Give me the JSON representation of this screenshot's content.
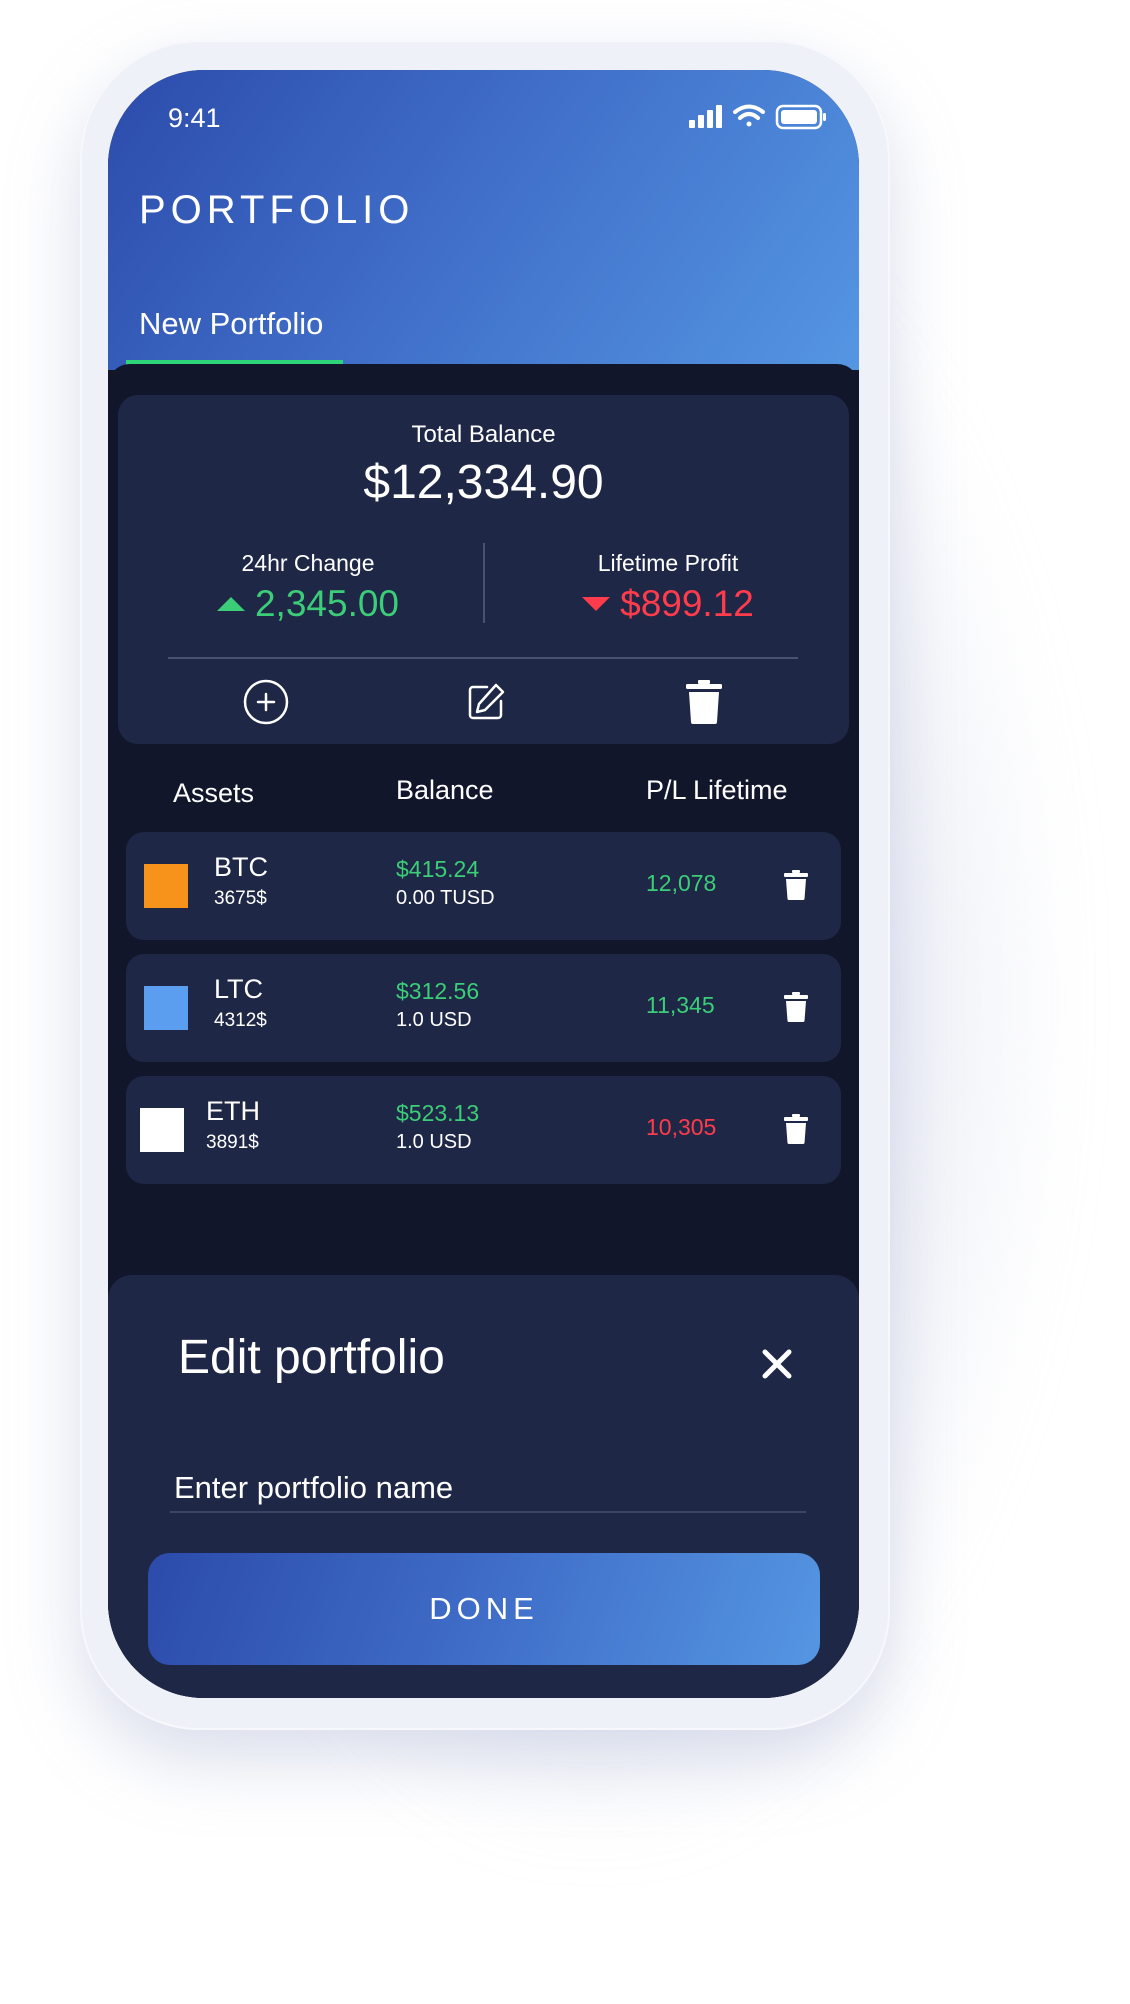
{
  "status_bar": {
    "time": "9:41"
  },
  "header": {
    "title": "PORTFOLIO",
    "tab": "New Portfolio"
  },
  "summary": {
    "total_label": "Total Balance",
    "total_value": "$12,334.90",
    "change_label": "24hr Change",
    "change_value": "2,345.00",
    "profit_label": "Lifetime Profit",
    "profit_value": "$899.12"
  },
  "actions": {
    "icons": [
      "add-circle-icon",
      "edit-icon",
      "trash-icon"
    ]
  },
  "assets_table": {
    "headers": {
      "assets": "Assets",
      "balance": "Balance",
      "pl": "P/L Lifetime"
    },
    "rows": [
      {
        "symbol": "BTC",
        "price": "3675$",
        "usd_value": "$415.24",
        "amount": "0.00 TUSD",
        "pl": "12,078",
        "pl_trend": "up",
        "color": "#f7931a"
      },
      {
        "symbol": "LTC",
        "price": "4312$",
        "usd_value": "$312.56",
        "amount": "1.0 USD",
        "pl": "11,345",
        "pl_trend": "up",
        "color": "#5b9ef0"
      },
      {
        "symbol": "ETH",
        "price": "3891$",
        "usd_value": "$523.13",
        "amount": "1.0 USD",
        "pl": "10,305",
        "pl_trend": "down",
        "color": "#ffffff"
      }
    ]
  },
  "edit_sheet": {
    "title": "Edit portfolio",
    "input_placeholder": "Enter portfolio name",
    "done_label": "DONE"
  },
  "colors": {
    "positive": "#3ccd78",
    "negative": "#ff3b4c",
    "tab_indicator": "#2fd37a",
    "card": "#1f2746"
  }
}
